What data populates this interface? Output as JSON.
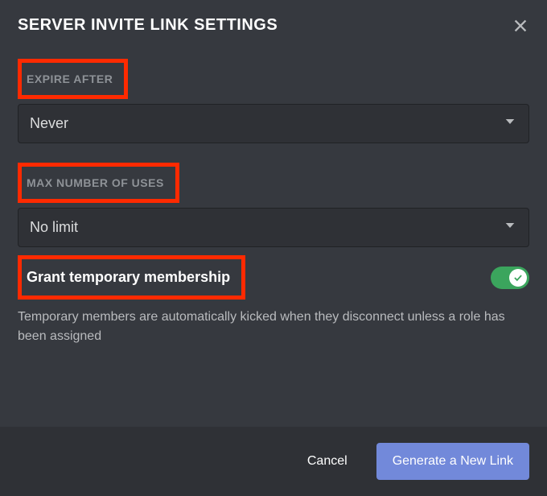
{
  "title": "SERVER INVITE LINK SETTINGS",
  "expire": {
    "label": "EXPIRE AFTER",
    "value": "Never"
  },
  "maxUses": {
    "label": "MAX NUMBER OF USES",
    "value": "No limit"
  },
  "tempMembership": {
    "label": "Grant temporary membership",
    "description": "Temporary members are automatically kicked when they disconnect unless a role has been assigned",
    "enabled": true
  },
  "footer": {
    "cancel": "Cancel",
    "generate": "Generate a New Link"
  }
}
